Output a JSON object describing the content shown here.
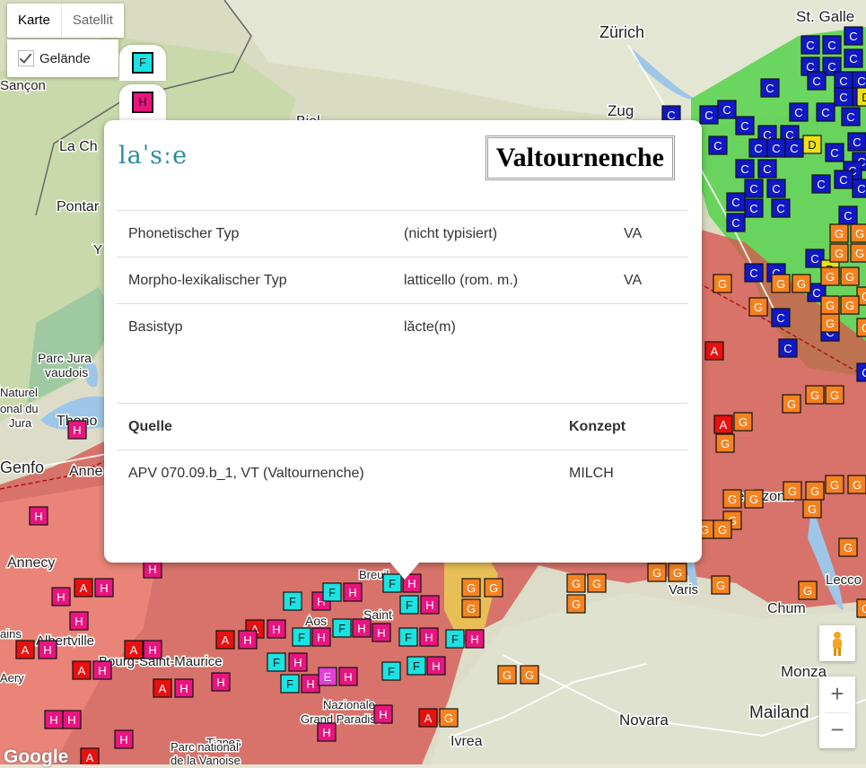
{
  "map_type": {
    "map_label": "Karte",
    "satellite_label": "Satellit",
    "terrain_label": "Gelände"
  },
  "tabs": [
    {
      "letter": "F",
      "color": "#19e3e3"
    },
    {
      "letter": "H",
      "color": "#e8157f"
    }
  ],
  "popup": {
    "ipa": "laˈsːe",
    "place": "Valtournenche",
    "types": [
      {
        "label": "Phonetischer Typ",
        "value": "(nicht typisiert)",
        "source": "VA"
      },
      {
        "label": "Morpho-lexikalischer Typ",
        "value": "latticello (rom. m.)",
        "source": "VA"
      },
      {
        "label": "Basistyp",
        "value": "lăcte(m)",
        "source": ""
      }
    ],
    "source_header": "Quelle",
    "concept_header": "Konzept",
    "sources": [
      {
        "source": "APV 070.09.b_1, VT (Valtournenche)",
        "concept": "MILCH"
      }
    ]
  },
  "place_labels": [
    "Zürich",
    "St. Galle",
    "Zug",
    "Biel",
    "La Ch",
    "Pontar",
    "Y",
    "Parc Jura",
    "vaudois",
    "Naturel",
    "onal du",
    "Jura",
    "Thono",
    "Genfo",
    "Anne",
    "Annecy",
    "Albertville",
    "Bourg-Saint-Maurice",
    "Tignes",
    "Bellinzona",
    "Monza",
    "Mailand",
    "Novara",
    "Ivrea",
    "Varis",
    "Chum",
    "Lecco",
    "Parc national",
    "de la Vanoise",
    "Grand Paradiso",
    "Nazionale",
    "Aos",
    "Saint",
    "Breuil",
    "ains",
    "Aery",
    "Sançon"
  ],
  "markers": {
    "colors": {
      "C": "#1018c8",
      "D": "#f0e010",
      "G": "#f5821f",
      "A": "#e81010",
      "H": "#e8157f",
      "F": "#19e3e3",
      "E": "#e43fd6"
    }
  },
  "zoom": {
    "in": "+",
    "out": "−"
  },
  "attribution": "Google"
}
